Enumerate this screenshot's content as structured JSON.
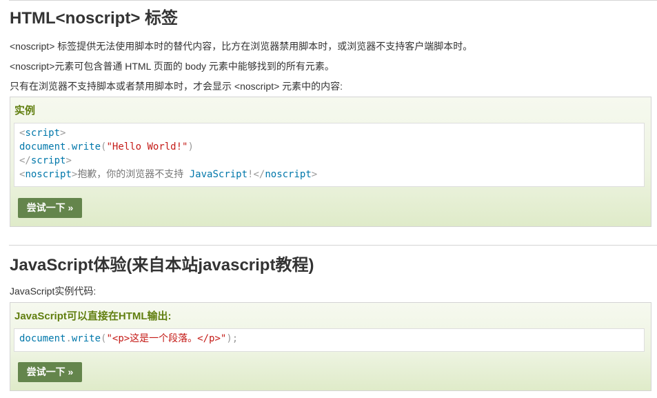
{
  "section1": {
    "title": "HTML<noscript> 标签",
    "para1": "<noscript> 标签提供无法使用脚本时的替代内容，比方在浏览器禁用脚本时，或浏览器不支持客户端脚本时。",
    "para2": "<noscript>元素可包含普通 HTML 页面的 body 元素中能够找到的所有元素。",
    "para3": "只有在浏览器不支持脚本或者禁用脚本时，才会显示 <noscript> 元素中的内容:",
    "example": {
      "heading": "实例",
      "code": {
        "l1_open": "<",
        "l1_tag": "script",
        "l1_close": ">",
        "l2_obj": "document",
        "l2_dot": ".",
        "l2_fn": "write",
        "l2_paren_open": "(",
        "l2_str": "\"Hello World!\"",
        "l2_paren_close": ")",
        "l3_open": "</",
        "l3_tag": "script",
        "l3_close": ">",
        "l4_open": "<",
        "l4_tag": "noscript",
        "l4_close": ">",
        "l4_text": "抱歉，你的浏览器不支持 ",
        "l4_js": "JavaScript",
        "l4_bang": "!",
        "l4_end_open": "</",
        "l4_end_tag": "noscript",
        "l4_end_close": ">"
      },
      "button": "尝试一下 »"
    }
  },
  "section2": {
    "title": "JavaScript体验(来自本站javascript教程)",
    "para1": "JavaScript实例代码:",
    "example": {
      "heading": "JavaScript可以直接在HTML输出:",
      "code": {
        "obj": "document",
        "dot": ".",
        "fn": "write",
        "paren_open": "(",
        "str": "\"<p>这是一个段落。</p>\"",
        "paren_close": ");"
      },
      "button": "尝试一下 »"
    }
  },
  "colors": {
    "heading_green": "#617f10",
    "button_green": "#64854c",
    "keyword_blue": "#0077aa",
    "string_red": "#c41a16",
    "tag_gray": "#999999"
  }
}
